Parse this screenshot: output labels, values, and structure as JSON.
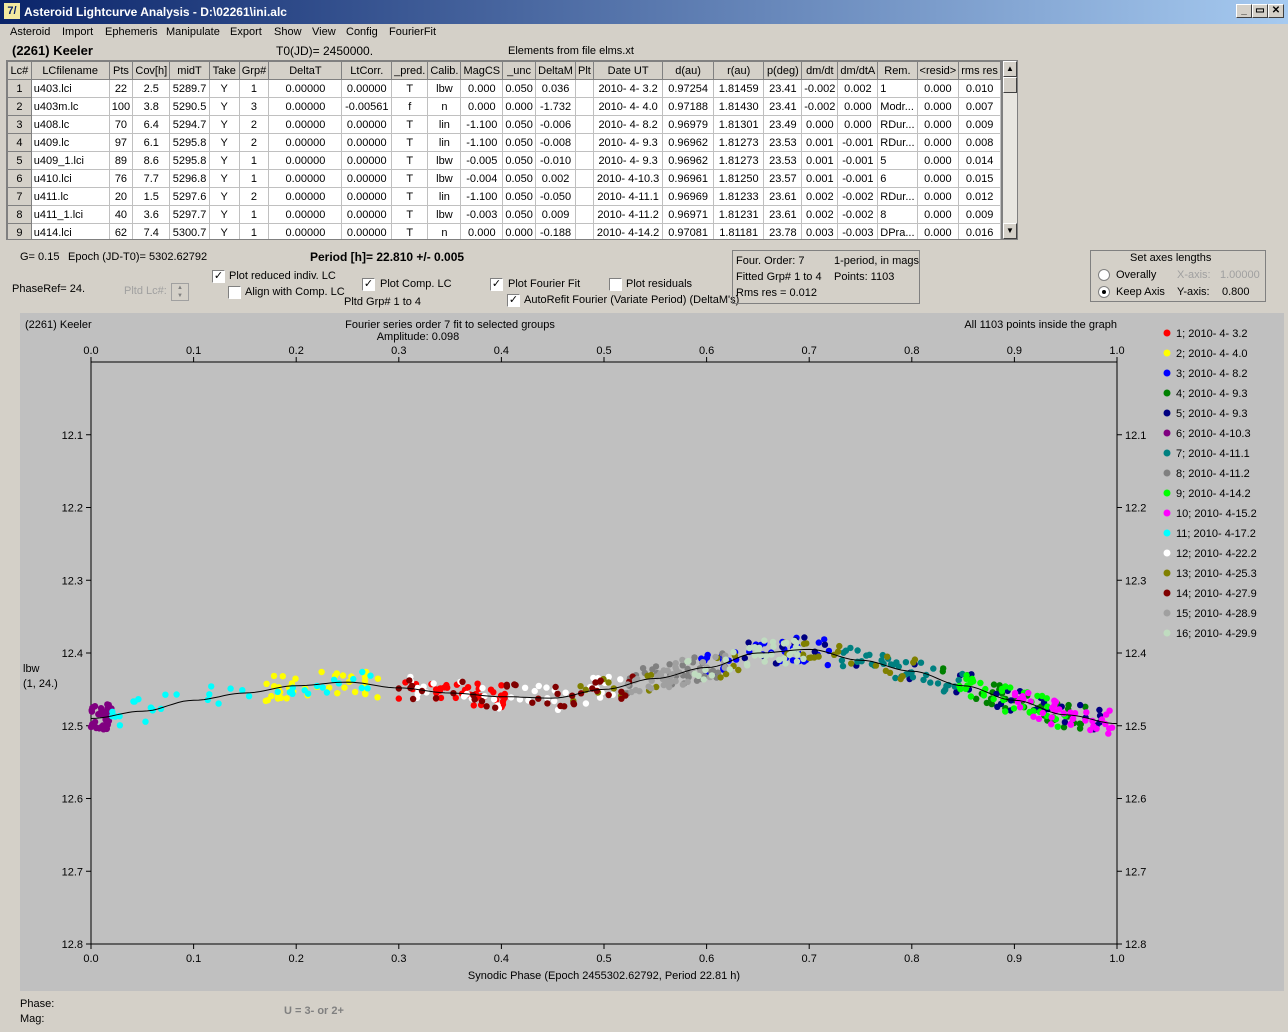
{
  "window": {
    "title": "Asteroid Lightcurve Analysis - D:\\02261\\ini.alc",
    "icon_glyph": "7/",
    "min_glyph": "_",
    "max_glyph": "▭",
    "close_glyph": "✕"
  },
  "menu": [
    "Asteroid",
    "Import",
    "Ephemeris",
    "Manipulate",
    "Export",
    "Show",
    "View",
    "Config",
    "FourierFit"
  ],
  "header": {
    "asteroid": "(2261) Keeler",
    "t0": "T0(JD)= 2450000.",
    "elements": "Elements from file elms.xt"
  },
  "table": {
    "columns": [
      "Lc#",
      "LCfilename",
      "Pts",
      "Cov[h]",
      "midT",
      "Take",
      "Grp#",
      "DeltaT",
      "LtCorr.",
      "_pred.",
      "Calib.",
      "MagCS",
      "_unc",
      "DeltaM",
      "Plt",
      "Date UT",
      "d(au)",
      "r(au)",
      "p(deg)",
      "dm/dt",
      "dm/dtA",
      "Rem.",
      "<resid>",
      "rms res"
    ],
    "rows": [
      [
        "1",
        "u403.lci",
        "22",
        "2.5",
        "5289.7",
        "Y",
        "1",
        "0.00000",
        "0.00000",
        "T",
        "lbw",
        "0.000",
        "0.050",
        "0.036",
        "",
        "2010- 4- 3.2",
        "0.97254",
        "1.81459",
        "23.41",
        "-0.002",
        "0.002",
        "1",
        "0.000",
        "0.010"
      ],
      [
        "2",
        "u403m.lc",
        "100",
        "3.8",
        "5290.5",
        "Y",
        "3",
        "0.00000",
        "-0.00561",
        "f",
        "n",
        "0.000",
        "0.000",
        "-1.732",
        "",
        "2010- 4- 4.0",
        "0.97188",
        "1.81430",
        "23.41",
        "-0.002",
        "0.000",
        "Modr...",
        "0.000",
        "0.007"
      ],
      [
        "3",
        "u408.lc",
        "70",
        "6.4",
        "5294.7",
        "Y",
        "2",
        "0.00000",
        "0.00000",
        "T",
        "lin",
        "-1.100",
        "0.050",
        "-0.006",
        "",
        "2010- 4- 8.2",
        "0.96979",
        "1.81301",
        "23.49",
        "0.000",
        "0.000",
        "RDur...",
        "0.000",
        "0.009"
      ],
      [
        "4",
        "u409.lc",
        "97",
        "6.1",
        "5295.8",
        "Y",
        "2",
        "0.00000",
        "0.00000",
        "T",
        "lin",
        "-1.100",
        "0.050",
        "-0.008",
        "",
        "2010- 4- 9.3",
        "0.96962",
        "1.81273",
        "23.53",
        "0.001",
        "-0.001",
        "RDur...",
        "0.000",
        "0.008"
      ],
      [
        "5",
        "u409_1.lci",
        "89",
        "8.6",
        "5295.8",
        "Y",
        "1",
        "0.00000",
        "0.00000",
        "T",
        "lbw",
        "-0.005",
        "0.050",
        "-0.010",
        "",
        "2010- 4- 9.3",
        "0.96962",
        "1.81273",
        "23.53",
        "0.001",
        "-0.001",
        "5",
        "0.000",
        "0.014"
      ],
      [
        "6",
        "u410.lci",
        "76",
        "7.7",
        "5296.8",
        "Y",
        "1",
        "0.00000",
        "0.00000",
        "T",
        "lbw",
        "-0.004",
        "0.050",
        "0.002",
        "",
        "2010- 4-10.3",
        "0.96961",
        "1.81250",
        "23.57",
        "0.001",
        "-0.001",
        "6",
        "0.000",
        "0.015"
      ],
      [
        "7",
        "u411.lc",
        "20",
        "1.5",
        "5297.6",
        "Y",
        "2",
        "0.00000",
        "0.00000",
        "T",
        "lin",
        "-1.100",
        "0.050",
        "-0.050",
        "",
        "2010- 4-11.1",
        "0.96969",
        "1.81233",
        "23.61",
        "0.002",
        "-0.002",
        "RDur...",
        "0.000",
        "0.012"
      ],
      [
        "8",
        "u411_1.lci",
        "40",
        "3.6",
        "5297.7",
        "Y",
        "1",
        "0.00000",
        "0.00000",
        "T",
        "lbw",
        "-0.003",
        "0.050",
        "0.009",
        "",
        "2010- 4-11.2",
        "0.96971",
        "1.81231",
        "23.61",
        "0.002",
        "-0.002",
        "8",
        "0.000",
        "0.009"
      ],
      [
        "9",
        "u414.lci",
        "62",
        "7.4",
        "5300.7",
        "Y",
        "1",
        "0.00000",
        "0.00000",
        "T",
        "n",
        "0.000",
        "0.000",
        "-0.188",
        "",
        "2010- 4-14.2",
        "0.97081",
        "1.81181",
        "23.78",
        "0.003",
        "-0.003",
        "DPra...",
        "0.000",
        "0.016"
      ]
    ]
  },
  "controls": {
    "g": "G= 0.15",
    "epoch": "Epoch (JD-T0)= 5302.62792",
    "period": "Period [h]= 22.810 +/- 0.005",
    "phaseref": "PhaseRef= 24.",
    "pltd_lc": "Pltd Lc#:",
    "plot_reduced": "Plot reduced indiv. LC",
    "align_comp": "Align with Comp. LC",
    "plot_comp": "Plot Comp. LC",
    "pltd_grp": "Pltd Grp#  1   to   4",
    "plot_fourier": "Plot Fourier Fit",
    "autorefit": "AutoRefit Fourier (Variate Period) (DeltaM's)",
    "plot_residuals": "Plot residuals",
    "checks": {
      "plot_reduced": true,
      "align_comp": false,
      "plot_comp": true,
      "plot_fourier": true,
      "autorefit": true,
      "plot_residuals": false
    }
  },
  "fourier_info": {
    "order": "Four. Order:  7",
    "mode": "1-period, in mags",
    "fitted": "Fitted Grp# 1 to 4",
    "points": "Points: 1103",
    "rms": "Rms res    = 0.012"
  },
  "axes_box": {
    "title": "Set axes lengths",
    "overally": "Overally",
    "keep_axis": "Keep Axis",
    "x_axis_label": "X-axis:",
    "x_axis_val": "1.00000",
    "y_axis_label": "Y-axis:",
    "y_axis_val": "0.800",
    "selected": "keep_axis"
  },
  "plot": {
    "name": "(2261) Keeler",
    "fit_caption": "Fourier series order 7 fit to selected groups",
    "amplitude": "Amplitude: 0.098",
    "inside": "All 1103 points inside the graph",
    "ylabel1": "lbw",
    "ylabel2": "(1, 24.)",
    "xlabel": "Synodic Phase (Epoch 2455302.62792, Period 22.81 h)"
  },
  "status": {
    "phase": "Phase:",
    "mag": "Mag:",
    "u": "U = 3- or 2+"
  },
  "chart_data": {
    "type": "scatter",
    "xlabel": "Synodic Phase (Epoch 2455302.62792, Period 22.81 h)",
    "ylabel": "lbw (1, 24.)",
    "xlim": [
      0.0,
      1.0
    ],
    "ylim": [
      12.0,
      12.8
    ],
    "y_inverted": true,
    "x_ticks": [
      "0.0",
      "0.1",
      "0.2",
      "0.3",
      "0.4",
      "0.5",
      "0.6",
      "0.7",
      "0.8",
      "0.9",
      "1.0"
    ],
    "y_ticks": [
      "12.1",
      "12.2",
      "12.3",
      "12.4",
      "12.5",
      "12.6",
      "12.7",
      "12.8"
    ],
    "grid": false,
    "legend_position": "right",
    "fit_curve": {
      "x": [
        0.0,
        0.05,
        0.1,
        0.15,
        0.2,
        0.25,
        0.3,
        0.35,
        0.4,
        0.45,
        0.5,
        0.55,
        0.6,
        0.65,
        0.7,
        0.75,
        0.8,
        0.85,
        0.9,
        0.95,
        1.0
      ],
      "y": [
        12.49,
        12.48,
        12.465,
        12.455,
        12.445,
        12.44,
        12.448,
        12.455,
        12.46,
        12.462,
        12.45,
        12.435,
        12.42,
        12.4,
        12.395,
        12.41,
        12.425,
        12.445,
        12.465,
        12.485,
        12.497
      ]
    },
    "series": [
      {
        "name": "1; 2010- 4- 3.2",
        "color": "#ff0000",
        "x_range": [
          0.3,
          0.41
        ],
        "y_center": 12.455
      },
      {
        "name": "2; 2010- 4- 4.0",
        "color": "#ffff00",
        "x_range": [
          0.17,
          0.28
        ],
        "y_center": 12.44
      },
      {
        "name": "3; 2010- 4- 8.2",
        "color": "#0000ff",
        "x_range": [
          0.59,
          0.72
        ],
        "y_center": 12.41
      },
      {
        "name": "4; 2010- 4- 9.3",
        "color": "#008000",
        "x_range": [
          0.83,
          0.97
        ],
        "y_center": 12.46
      },
      {
        "name": "5; 2010- 4- 9.3",
        "color": "#000080",
        "x_range": [
          0.62,
          1.0
        ],
        "y_center": 12.44
      },
      {
        "name": "6; 2010- 4-10.3",
        "color": "#800080",
        "x_range": [
          0.0,
          0.02
        ],
        "y_center": 12.5
      },
      {
        "name": "7; 2010- 4-11.1",
        "color": "#008080",
        "x_range": [
          0.72,
          0.85
        ],
        "y_center": 12.42
      },
      {
        "name": "8; 2010- 4-11.2",
        "color": "#808080",
        "x_range": [
          0.52,
          0.62
        ],
        "y_center": 12.43
      },
      {
        "name": "9; 2010- 4-14.2",
        "color": "#00ff00",
        "x_range": [
          0.84,
          0.95
        ],
        "y_center": 12.47
      },
      {
        "name": "10; 2010- 4-15.2",
        "color": "#ff00ff",
        "x_range": [
          0.9,
          1.0
        ],
        "y_center": 12.48
      },
      {
        "name": "11; 2010- 4-17.2",
        "color": "#00ffff",
        "x_range": [
          0.02,
          0.28
        ],
        "y_center": 12.46
      },
      {
        "name": "12; 2010- 4-22.2",
        "color": "#ffffff",
        "x_range": [
          0.31,
          0.52
        ],
        "y_center": 12.46
      },
      {
        "name": "13; 2010- 4-25.3",
        "color": "#808000",
        "x_range": [
          0.47,
          0.82
        ],
        "y_center": 12.42
      },
      {
        "name": "14; 2010- 4-27.9",
        "color": "#800000",
        "x_range": [
          0.3,
          0.53
        ],
        "y_center": 12.44
      },
      {
        "name": "15; 2010- 4-28.9",
        "color": "#a0a0a0",
        "x_range": [
          0.52,
          0.62
        ],
        "y_center": 12.43
      },
      {
        "name": "16; 2010- 4-29.9",
        "color": "#c0dcc0",
        "x_range": [
          0.58,
          0.7
        ],
        "y_center": 12.41
      }
    ]
  }
}
